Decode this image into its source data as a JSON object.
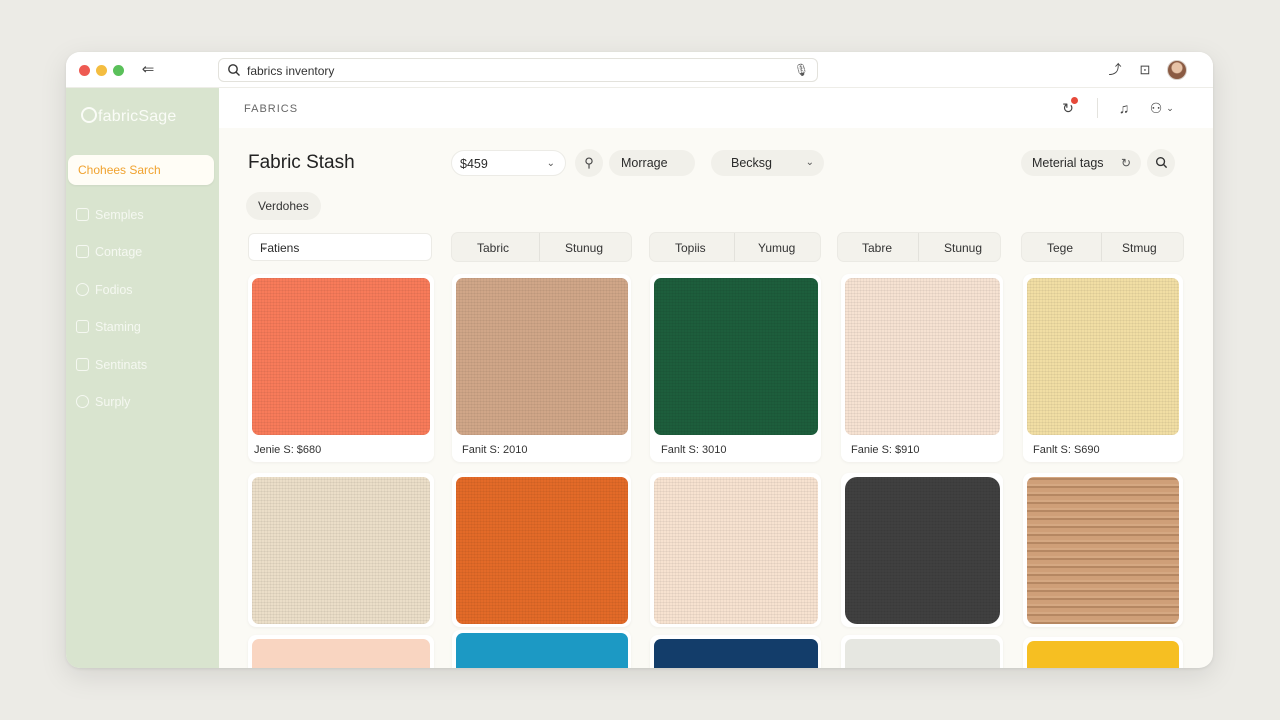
{
  "browser": {
    "search_query": "fabrics inventory"
  },
  "sidebar": {
    "logo": "fabricSage",
    "active_item": "Chohees Sarch",
    "items": [
      {
        "label": "Semples",
        "icon": "grid-icon"
      },
      {
        "label": "Contage",
        "icon": "calendar-icon"
      },
      {
        "label": "Fodios",
        "icon": "clock-icon"
      },
      {
        "label": "Staming",
        "icon": "box-icon"
      },
      {
        "label": "Sentinats",
        "icon": "settings-icon"
      },
      {
        "label": "Surply",
        "icon": "tag-icon"
      }
    ]
  },
  "header": {
    "breadcrumb": "FABRICS"
  },
  "toolbar": {
    "title": "Fabric Stash",
    "price_select": "$459",
    "filter1": "Morrage",
    "filter2": "Becksg",
    "material_tags": "Meterial tags"
  },
  "chip": "Verdohes",
  "filter_row": {
    "select": "Fatiens",
    "groups": [
      {
        "a": "Tabric",
        "b": "Stunug"
      },
      {
        "a": "Topiis",
        "b": "Yumug"
      },
      {
        "a": "Tabre",
        "b": "Stunug"
      },
      {
        "a": "Tege",
        "b": "Stmug"
      }
    ]
  },
  "swatches_row1": [
    {
      "caption": "Jenie S: $680",
      "color": "#f87b5a"
    },
    {
      "caption": "Fanit S: 2010",
      "color": "#d0a688"
    },
    {
      "caption": "Fanlt S: 3010",
      "color": "#1d5e3c"
    },
    {
      "caption": "Fanie S: $910",
      "color": "#f6e2d2"
    },
    {
      "caption": "Fanlt S: S690",
      "color": "#f1dea4"
    }
  ],
  "swatches_row2": [
    {
      "color": "#ebdec8"
    },
    {
      "color": "#e36a28"
    },
    {
      "color": "#f7e2d0"
    },
    {
      "color": "#404040"
    },
    {
      "color": "#cf9f78"
    }
  ],
  "swatches_row3": [
    {
      "color": "#f9d5c1"
    },
    {
      "color": "#1c99c4"
    },
    {
      "color": "#133d6a"
    },
    {
      "color": "#e6e7e1"
    },
    {
      "color": "#f6bf22"
    }
  ]
}
